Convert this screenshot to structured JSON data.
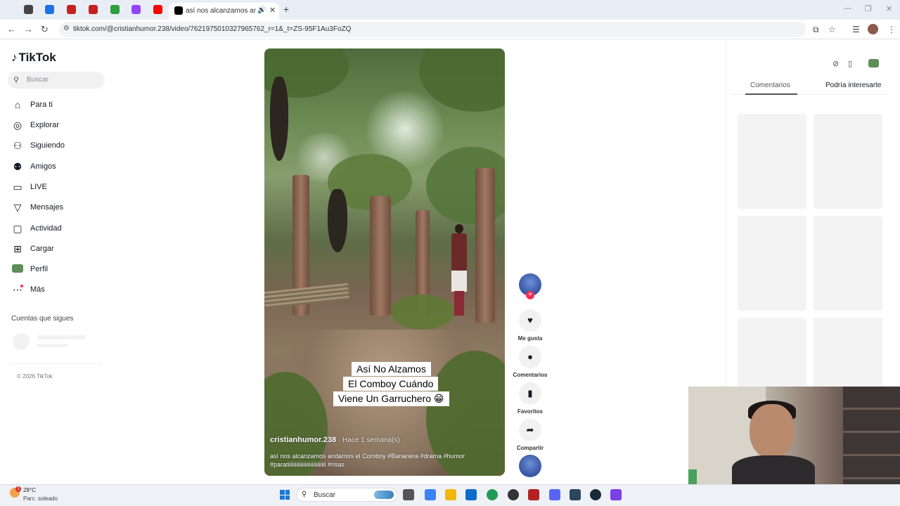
{
  "browser": {
    "tab_title": "así nos alcanzamos andamos el Comboy",
    "sound_icon": "speaker-icon",
    "new_tab_label": "+",
    "url": "tiktok.com/@cristianhumor.238/video/7621975010327965762_r=1&_t=ZS-95F1Au3FoZQ",
    "tab_icon_colors": [
      "#444444",
      "#1a73e8",
      "#c5221f",
      "#c5221f",
      "#2e9e3e",
      "#9146ff",
      "#ff0000"
    ]
  },
  "sidebar": {
    "brand": "TikTok",
    "search_placeholder": "Buscar",
    "nav": [
      {
        "label": "Para ti",
        "icon": "home-icon"
      },
      {
        "label": "Explorar",
        "icon": "compass-icon"
      },
      {
        "label": "Siguiendo",
        "icon": "following-icon"
      },
      {
        "label": "Amigos",
        "icon": "friends-icon"
      },
      {
        "label": "LIVE",
        "icon": "live-icon"
      },
      {
        "label": "Mensajes",
        "icon": "send-icon"
      },
      {
        "label": "Actividad",
        "icon": "inbox-icon"
      },
      {
        "label": "Cargar",
        "icon": "upload-icon"
      },
      {
        "label": "Perfil",
        "icon": "profile-avatar-icon"
      },
      {
        "label": "Más",
        "icon": "more-icon"
      }
    ],
    "following_title": "Cuentas que sigues",
    "copyright": "© 2026 TikTok"
  },
  "video": {
    "captions": [
      "Así No Alzamos",
      "El Comboy Cuándo",
      "Viene Un Garruchero 😁"
    ],
    "username": "cristianhumor.238",
    "posted": " · Hace 1 semana(s)",
    "description": "así nos alcanzamos andamos el Comboy #Bananera #drama #humor #paratiiiiiiiiiiiiiiiiiiiiiiiiiii #risas"
  },
  "actions": {
    "follow_plus": "+",
    "like": "Me gusta",
    "comments": "Comentarios",
    "favorites": "Favoritos",
    "share": "Compartir"
  },
  "right_panel": {
    "tab_comments": "Comentarios",
    "tab_suggest": "Podría interesarte"
  },
  "taskbar": {
    "temp": "28°C",
    "weather": "Parc. soleado",
    "weather_badge": "1",
    "search_placeholder": "Buscar",
    "app_colors": [
      "#555555",
      "#3b82f6",
      "#f2b705",
      "#0b6bcb",
      "#1f9d55",
      "#333333",
      "#b22222",
      "#5865f2",
      "#2a475e",
      "#1b2838",
      "#7b3fe4"
    ]
  }
}
